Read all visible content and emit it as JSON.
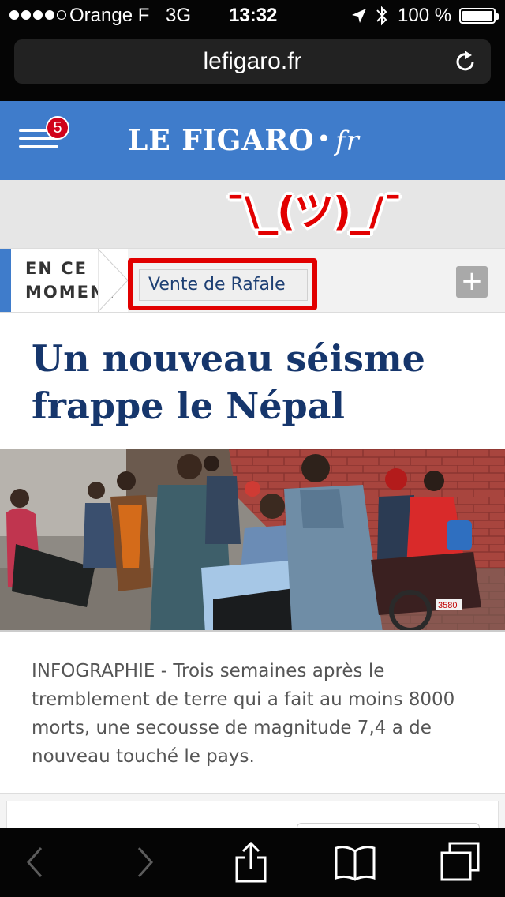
{
  "status_bar": {
    "carrier": "Orange F",
    "network": "3G",
    "time": "13:32",
    "battery": "100 %",
    "signal_bars": 4
  },
  "safari": {
    "url": "lefigaro.fr"
  },
  "header": {
    "logo_main": "LE FIGARO",
    "logo_dot": "•",
    "logo_suffix": "fr",
    "notification_count": "5",
    "brand_color": "#3f7ccb"
  },
  "overlay": {
    "shrug": "¯\\_(ツ)_/¯",
    "highlight_color": "#e10000"
  },
  "trending": {
    "label_line1": "EN CE",
    "label_line2": "MOMENT",
    "tag": "Vente de Rafale",
    "more_button": "+"
  },
  "article": {
    "headline": "Un nouveau séisme frappe le Népal",
    "summary": "INFOGRAPHIE - Trois semaines après le tremblement de terre qui a fait au moins 8000 morts, une secousse de magnitude 7,4 a de nouveau touché le pays.",
    "photo_plate": "3580"
  },
  "toolbar": {
    "items": [
      "back-icon",
      "forward-icon",
      "share-icon",
      "bookmarks-icon",
      "tabs-icon"
    ]
  }
}
